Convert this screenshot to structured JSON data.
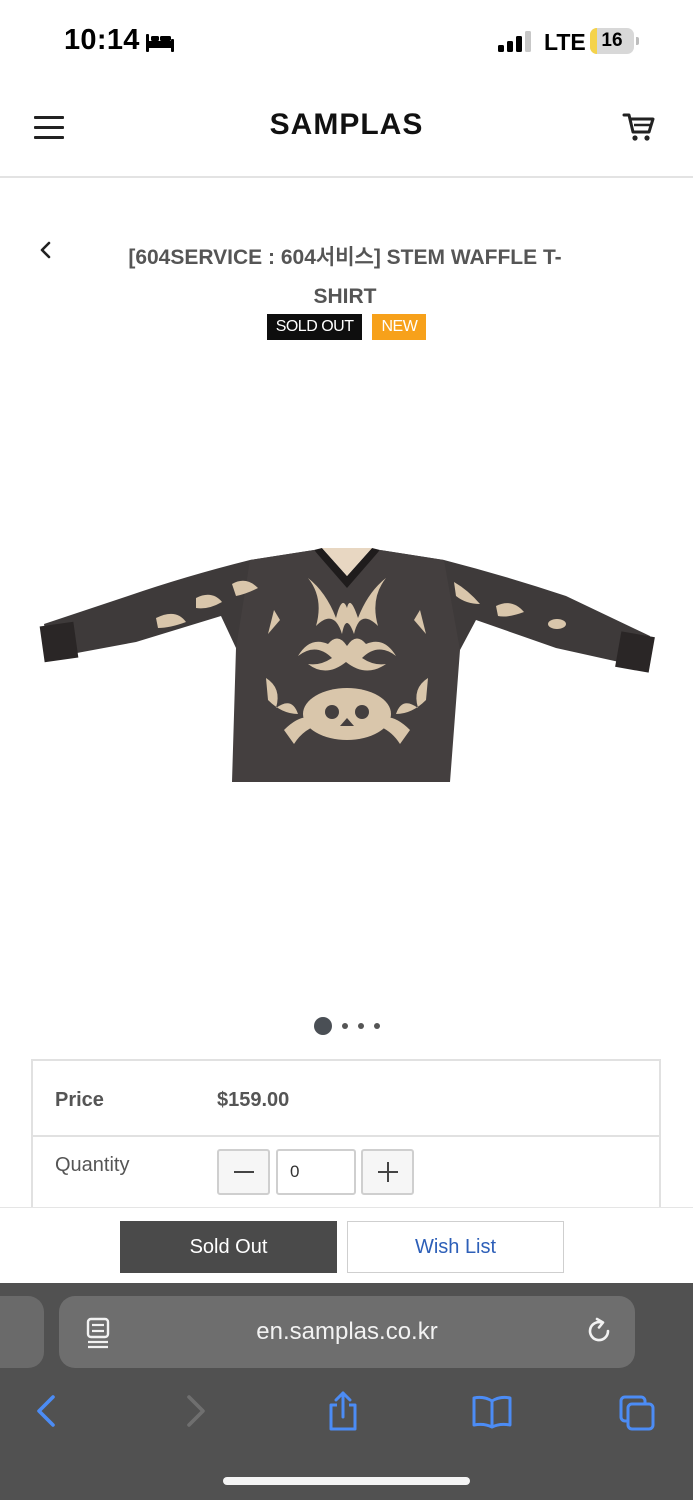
{
  "status_bar": {
    "time": "10:14",
    "network": "LTE",
    "battery_level": "16",
    "battery_fraction": 0.16,
    "battery_color": "#f5d34a"
  },
  "header": {
    "logo": "SAMPLAS"
  },
  "product": {
    "title": "[604SERVICE : 604서비스] STEM WAFFLE T-SHIRT",
    "badges": [
      "SOLD OUT",
      "NEW"
    ],
    "badge_colors": [
      "#0e0e0e",
      "#f7a11a"
    ],
    "image_icon": "long-sleeve-shirt-image",
    "image_pager": {
      "current_page": 1,
      "total_pages": 4
    }
  },
  "info": {
    "price_label": "Price",
    "price_value": "$159.00",
    "quantity_label": "Quantity",
    "quantity_value": "0"
  },
  "actions": {
    "soldout_label": "Sold Out",
    "wishlist_label": "Wish List",
    "wishlist_color": "#2d5fb8"
  },
  "browser": {
    "url": "en.samplas.co.kr",
    "accent_color": "#4c8cf5"
  }
}
